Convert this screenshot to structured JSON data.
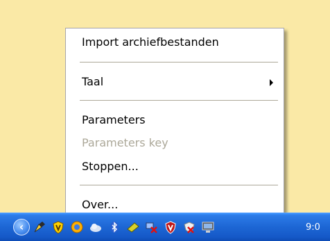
{
  "menu": {
    "items": [
      {
        "label": "Import archiefbestanden",
        "enabled": true
      },
      {
        "label": "Taal",
        "enabled": true,
        "has_submenu": true
      },
      {
        "label": "Parameters",
        "enabled": true
      },
      {
        "label": "Parameters key",
        "enabled": false
      },
      {
        "label": "Stoppen...",
        "enabled": true
      },
      {
        "label": "Over...",
        "enabled": true
      }
    ]
  },
  "taskbar": {
    "clock": "9:0",
    "tray_icons": [
      "tray-expand-icon",
      "pen-tool-icon",
      "shield-icon",
      "network-globe-icon",
      "cloud-icon",
      "bluetooth-icon",
      "usb-stick-icon",
      "network-disconnected-icon",
      "antivirus-shield-icon",
      "security-alert-icon",
      "monitor-icon"
    ]
  },
  "colors": {
    "desktop": "#fae9a6",
    "taskbar": "#1d66d4",
    "menu_bg": "#ffffff",
    "disabled_text": "#aca899"
  }
}
